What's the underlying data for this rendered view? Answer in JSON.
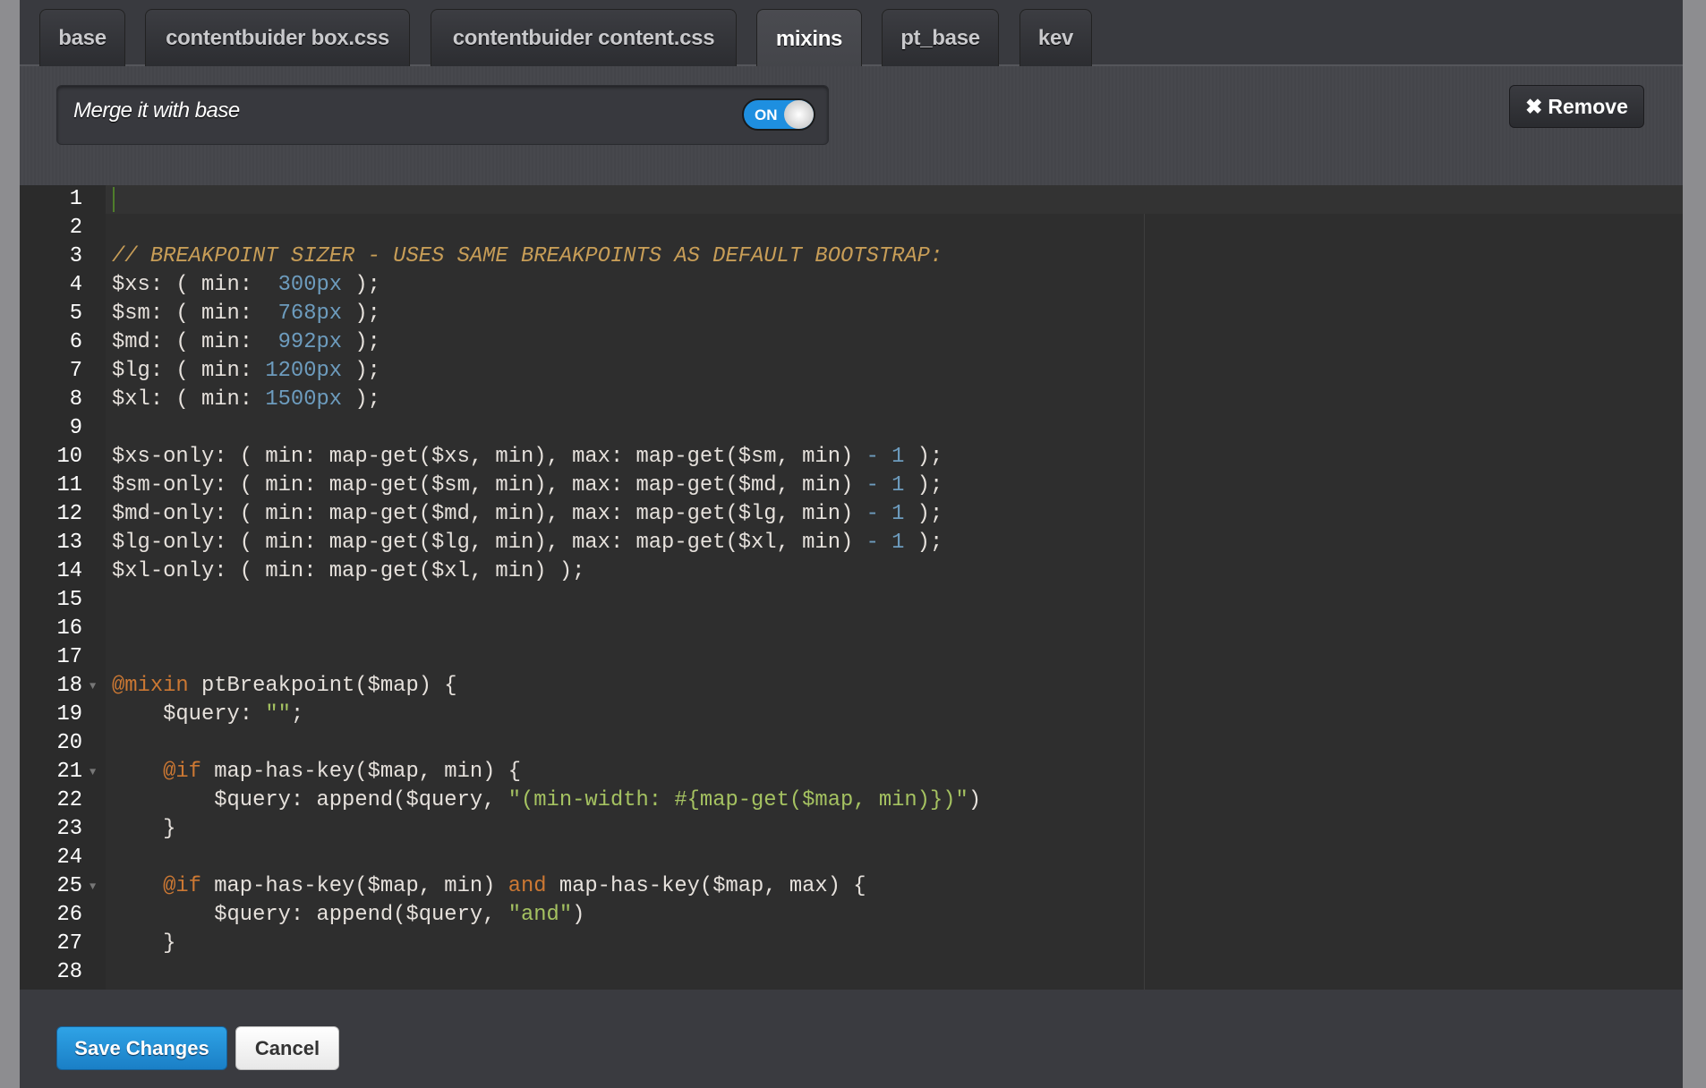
{
  "tabs": [
    {
      "label": "base",
      "active": false
    },
    {
      "label": "contentbuider box.css",
      "active": false
    },
    {
      "label": "contentbuider content.css",
      "active": false
    },
    {
      "label": "mixins",
      "active": true
    },
    {
      "label": "pt_base",
      "active": false
    },
    {
      "label": "kev",
      "active": false
    }
  ],
  "merge": {
    "label": "Merge it with base",
    "toggle_text": "ON",
    "toggle_on": true
  },
  "remove_button": {
    "icon": "x-icon",
    "label": "Remove"
  },
  "editor": {
    "colors": {
      "comment": "#c79d57",
      "number": "#6d9cbe",
      "keyword": "#cc7833",
      "string": "#a5c261",
      "text": "#e6e1dc"
    },
    "lines": [
      [],
      [],
      [
        [
          "comment",
          "// BREAKPOINT SIZER - USES SAME BREAKPOINTS AS DEFAULT BOOTSTRAP:"
        ]
      ],
      [
        [
          "text",
          "$xs: ( min:  "
        ],
        [
          "num",
          "300px"
        ],
        [
          "text",
          " );"
        ]
      ],
      [
        [
          "text",
          "$sm: ( min:  "
        ],
        [
          "num",
          "768px"
        ],
        [
          "text",
          " );"
        ]
      ],
      [
        [
          "text",
          "$md: ( min:  "
        ],
        [
          "num",
          "992px"
        ],
        [
          "text",
          " );"
        ]
      ],
      [
        [
          "text",
          "$lg: ( min: "
        ],
        [
          "num",
          "1200px"
        ],
        [
          "text",
          " );"
        ]
      ],
      [
        [
          "text",
          "$xl: ( min: "
        ],
        [
          "num",
          "1500px"
        ],
        [
          "text",
          " );"
        ]
      ],
      [],
      [
        [
          "text",
          "$xs-only: ( min: map-get($xs, min), max: map-get($sm, min) "
        ],
        [
          "op",
          "-"
        ],
        [
          "text",
          " "
        ],
        [
          "num",
          "1"
        ],
        [
          "text",
          " );"
        ]
      ],
      [
        [
          "text",
          "$sm-only: ( min: map-get($sm, min), max: map-get($md, min) "
        ],
        [
          "op",
          "-"
        ],
        [
          "text",
          " "
        ],
        [
          "num",
          "1"
        ],
        [
          "text",
          " );"
        ]
      ],
      [
        [
          "text",
          "$md-only: ( min: map-get($md, min), max: map-get($lg, min) "
        ],
        [
          "op",
          "-"
        ],
        [
          "text",
          " "
        ],
        [
          "num",
          "1"
        ],
        [
          "text",
          " );"
        ]
      ],
      [
        [
          "text",
          "$lg-only: ( min: map-get($lg, min), max: map-get($xl, min) "
        ],
        [
          "op",
          "-"
        ],
        [
          "text",
          " "
        ],
        [
          "num",
          "1"
        ],
        [
          "text",
          " );"
        ]
      ],
      [
        [
          "text",
          "$xl-only: ( min: map-get($xl, min) );"
        ]
      ],
      [],
      [],
      [],
      [
        [
          "kw",
          "@mixin"
        ],
        [
          "text",
          " ptBreakpoint($map) {"
        ]
      ],
      [
        [
          "text",
          "    $query: "
        ],
        [
          "str",
          "\"\""
        ],
        [
          "text",
          ";"
        ]
      ],
      [],
      [
        [
          "text",
          "    "
        ],
        [
          "kw",
          "@if"
        ],
        [
          "text",
          " map-has-key($map, min) {"
        ]
      ],
      [
        [
          "text",
          "        $query: append($query, "
        ],
        [
          "str",
          "\"(min-width: #{map-get($map, min)})\""
        ],
        [
          "text",
          ")"
        ]
      ],
      [
        [
          "text",
          "    }"
        ]
      ],
      [],
      [
        [
          "text",
          "    "
        ],
        [
          "kw",
          "@if"
        ],
        [
          "text",
          " map-has-key($map, min) "
        ],
        [
          "kw",
          "and"
        ],
        [
          "text",
          " map-has-key($map, max) {"
        ]
      ],
      [
        [
          "text",
          "        $query: append($query, "
        ],
        [
          "str",
          "\"and\""
        ],
        [
          "text",
          ")"
        ]
      ],
      [
        [
          "text",
          "    }"
        ]
      ],
      []
    ],
    "fold_lines": [
      18,
      21,
      25
    ]
  },
  "footer": {
    "save_label": "Save Changes",
    "cancel_label": "Cancel"
  }
}
